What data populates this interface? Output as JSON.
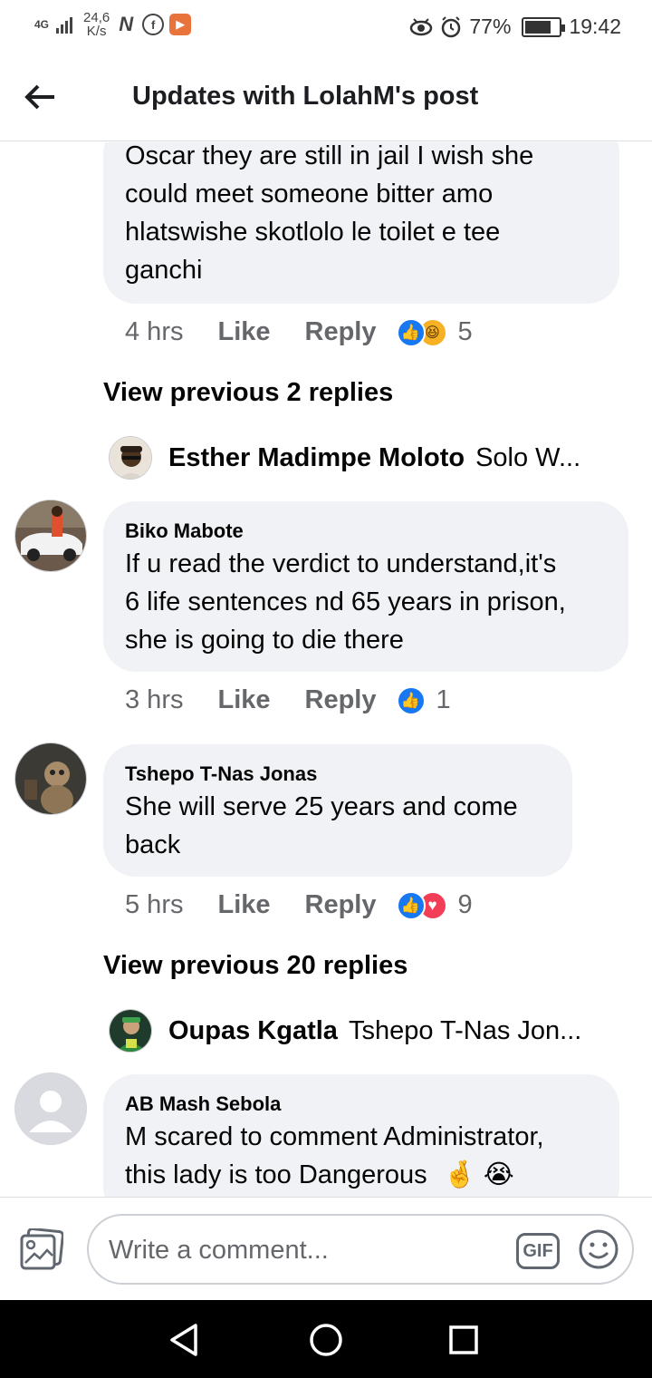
{
  "status_bar": {
    "network": "4G",
    "speed_value": "24,6",
    "speed_unit": "K/s",
    "battery": "77%",
    "battery_level": 0.77,
    "time": "19:42",
    "notification_icons": [
      "netflix-n-icon",
      "facebook-icon",
      "video-player-icon"
    ],
    "right_icons": [
      "eye-icon",
      "alarm-icon",
      "battery-icon"
    ]
  },
  "header": {
    "title": "Updates with LolahM's post"
  },
  "comments": [
    {
      "text": "Oscar they are still in jail I wish she could meet someone bitter amo hlatswishe skotlolo le toilet e tee ganchi",
      "lines": [
        "Oscar they are still in jail I wish she",
        "could meet someone bitter amo",
        "hlatswishe skotlolo le toilet e tee",
        "ganchi"
      ],
      "time": "4 hrs",
      "like": "Like",
      "reply": "Reply",
      "reactions": [
        "like",
        "haha"
      ],
      "reaction_count": "5"
    },
    {
      "author": "Biko Mabote",
      "lines": [
        "If u read the verdict to understand,it's",
        "6 life sentences nd 65 years in prison,",
        "she is going to die there"
      ],
      "time": "3 hrs",
      "like": "Like",
      "reply": "Reply",
      "reactions": [
        "like"
      ],
      "reaction_count": "1"
    },
    {
      "author": "Tshepo T-Nas Jonas",
      "lines": [
        "She will serve 25 years and come",
        "back"
      ],
      "time": "5 hrs",
      "like": "Like",
      "reply": "Reply",
      "reactions": [
        "like",
        "love"
      ],
      "reaction_count": "9"
    },
    {
      "author": "AB Mash Sebola",
      "lines": [
        "M scared to comment Administrator,",
        "this lady is too Dangerous"
      ],
      "emojis": [
        "🤞",
        "😭"
      ]
    }
  ],
  "view_previous": [
    {
      "label": "View previous 2 replies"
    },
    {
      "label": "View previous 20 replies"
    }
  ],
  "reply_previews": [
    {
      "name": "Esther Madimpe Moloto",
      "snippet": "Solo W..."
    },
    {
      "name": "Oupas Kgatla",
      "snippet": "Tshepo T-Nas Jon..."
    }
  ],
  "composer": {
    "placeholder": "Write a comment...",
    "gif_label": "GIF"
  }
}
